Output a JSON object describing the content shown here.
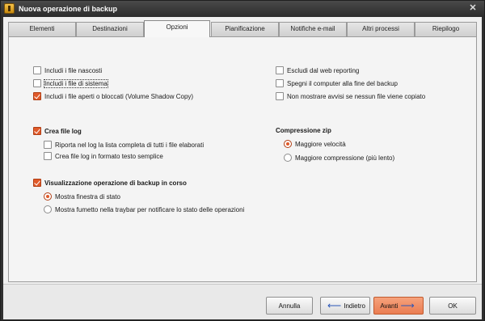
{
  "window": {
    "title": "Nuova operazione di backup",
    "close_glyph": "✕"
  },
  "tabs": [
    {
      "label": "Elementi"
    },
    {
      "label": "Destinazioni"
    },
    {
      "label": "Opzioni",
      "active": true
    },
    {
      "label": "Pianificazione"
    },
    {
      "label": "Notifiche e-mail"
    },
    {
      "label": "Altri processi"
    },
    {
      "label": "Riepilogo"
    }
  ],
  "options": {
    "left": [
      {
        "label": "Includi i file nascosti",
        "checked": false
      },
      {
        "label": "Includi i file di sistema",
        "checked": false,
        "focused": true
      },
      {
        "label": "Includi i file aperti o bloccati (Volume Shadow Copy)",
        "checked": true
      }
    ],
    "right": [
      {
        "label": "Escludi dal web reporting",
        "checked": false
      },
      {
        "label": "Spegni il computer alla fine del backup",
        "checked": false
      },
      {
        "label": "Non mostrare avvisi se nessun file viene copiato",
        "checked": false
      }
    ]
  },
  "log": {
    "label": "Crea file log",
    "checked": true,
    "sub": [
      {
        "label": "Riporta nel log la lista completa di tutti i file elaborati",
        "checked": false
      },
      {
        "label": "Crea file log in formato testo semplice",
        "checked": false
      }
    ]
  },
  "zip": {
    "title": "Compressione zip",
    "options": [
      {
        "label": "Maggiore velocità",
        "selected": true
      },
      {
        "label": "Maggiore compressione (più lento)",
        "selected": false
      }
    ]
  },
  "display": {
    "label": "Visualizzazione operazione di backup in corso",
    "checked": true,
    "options": [
      {
        "label": "Mostra finestra di stato",
        "selected": true
      },
      {
        "label": "Mostra fumetto nella traybar per notificare lo stato delle operazioni",
        "selected": false
      }
    ]
  },
  "buttons": {
    "cancel": "Annulla",
    "back": "Indietro",
    "next": "Avanti",
    "ok": "OK",
    "back_arrow": "⟵",
    "next_arrow": "⟶"
  },
  "colors": {
    "accent": "#e05a2a",
    "primary_button": "#ea7d52",
    "arrow_blue": "#2a56b8"
  }
}
